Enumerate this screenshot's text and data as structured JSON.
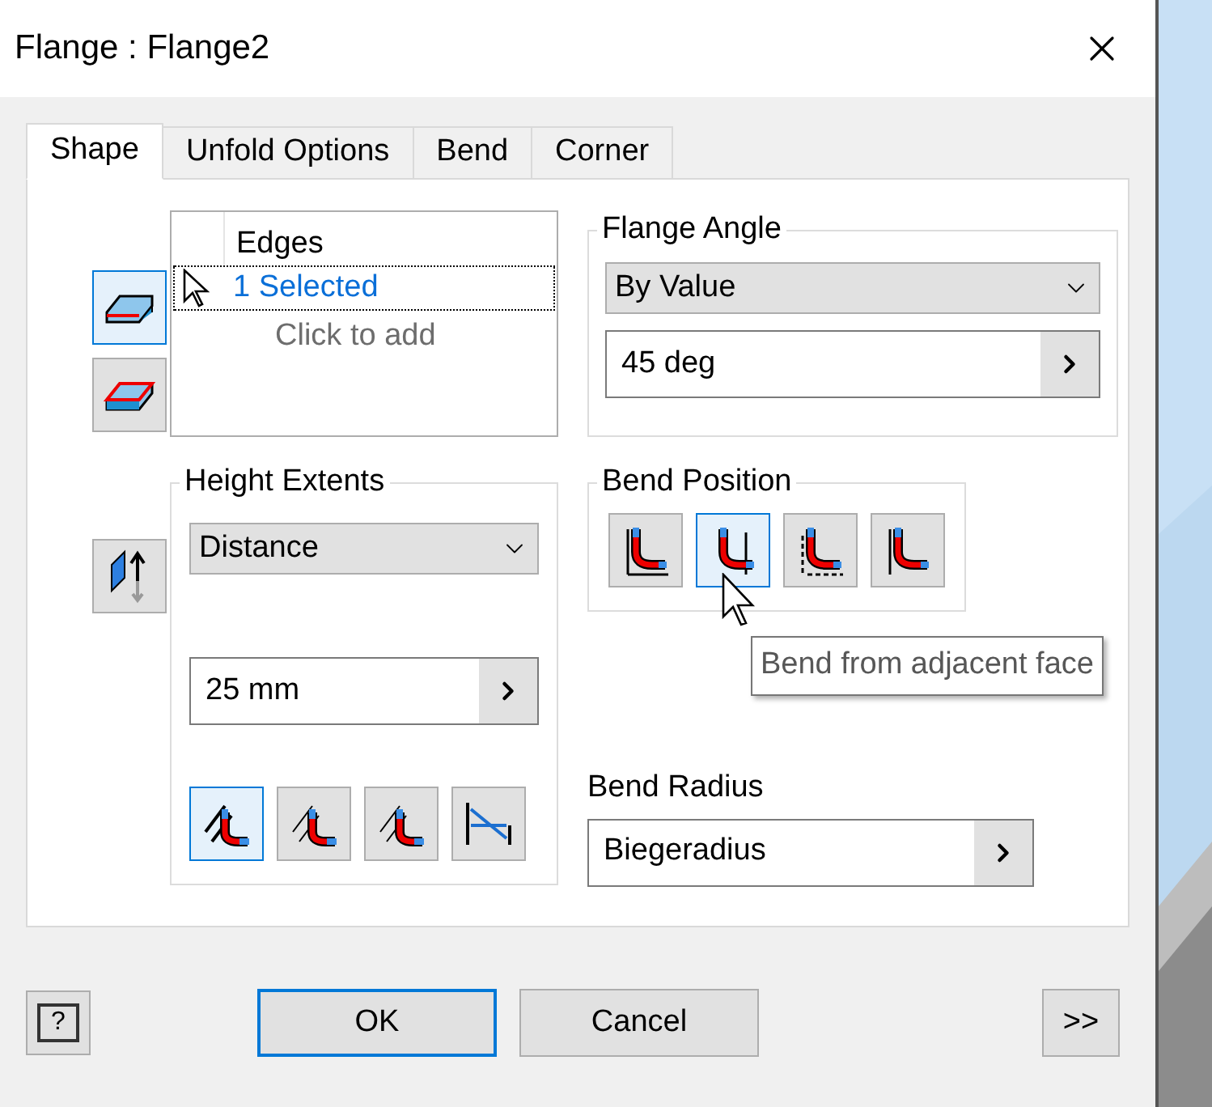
{
  "window": {
    "title": "Flange : Flange2"
  },
  "tabs": [
    {
      "label": "Shape",
      "selected": true
    },
    {
      "label": "Unfold Options",
      "selected": false
    },
    {
      "label": "Bend",
      "selected": false
    },
    {
      "label": "Corner",
      "selected": false
    }
  ],
  "side_buttons": [
    {
      "selected": true
    },
    {
      "selected": false
    },
    {
      "selected": false
    }
  ],
  "edges": {
    "header": "Edges",
    "value": "1 Selected",
    "hint": "Click to add"
  },
  "flange_angle": {
    "label": "Flange Angle",
    "dropdown": "By Value",
    "value": "45 deg"
  },
  "height_extents": {
    "label": "Height Extents",
    "dropdown": "Distance",
    "value": "25 mm",
    "buttons": [
      {
        "selected": true
      },
      {
        "selected": false
      },
      {
        "selected": false
      },
      {
        "selected": false
      }
    ]
  },
  "bend_position": {
    "label": "Bend Position",
    "buttons": [
      {
        "selected": false
      },
      {
        "selected": true
      },
      {
        "selected": false
      },
      {
        "selected": false
      }
    ]
  },
  "tooltip": "Bend from adjacent face",
  "bend_radius": {
    "label": "Bend Radius",
    "value": "Biegeradius"
  },
  "footer": {
    "help": "?",
    "ok": "OK",
    "cancel": "Cancel",
    "more": ">>"
  }
}
